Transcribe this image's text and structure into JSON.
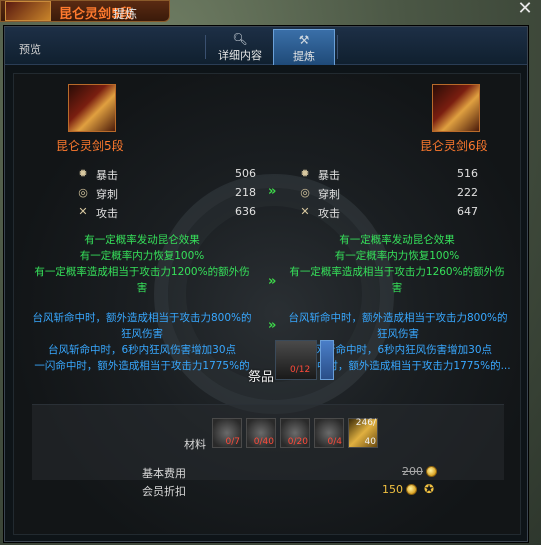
{
  "title": {
    "item_name": "昆仑灵剑5段",
    "mode": "提炼"
  },
  "header": {
    "preview_label": "预览",
    "tabs": [
      {
        "label": "详细内容",
        "icon": "magnifier-icon"
      },
      {
        "label": "提炼",
        "icon": "hammer-icon"
      }
    ],
    "active_tab": 1
  },
  "left_item": {
    "name": "昆仑灵剑5段",
    "stats": [
      {
        "icon": "crit-icon",
        "name": "暴击",
        "value": "506"
      },
      {
        "icon": "pierce-icon",
        "name": "穿刺",
        "value": "218"
      },
      {
        "icon": "attack-icon",
        "name": "攻击",
        "value": "636"
      }
    ],
    "effects_green": [
      "有一定概率发动昆仑效果",
      "有一定概率内力恢复100%",
      "有一定概率造成相当于攻击力1200%的额外伤",
      "害"
    ],
    "effects_blue": [
      "台风斩命中时，额外造成相当于攻击力800%的",
      "狂风伤害",
      "台风斩命中时，6秒内狂风伤害增加30点",
      "一闪命中时，额外造成相当于攻击力1775%的"
    ]
  },
  "right_item": {
    "name": "昆仑灵剑6段",
    "stats": [
      {
        "icon": "crit-icon",
        "name": "暴击",
        "value": "516"
      },
      {
        "icon": "pierce-icon",
        "name": "穿刺",
        "value": "222"
      },
      {
        "icon": "attack-icon",
        "name": "攻击",
        "value": "647"
      }
    ],
    "effects_green": [
      "有一定概率发动昆仑效果",
      "有一定概率内力恢复100%",
      "有一定概率造成相当于攻击力1260%的额外伤",
      "害"
    ],
    "effects_blue": [
      "台风斩命中时，额外造成相当于攻击力800%的",
      "狂风伤害",
      "台风斩命中时，6秒内狂风伤害增加30点",
      "一闪命中时，额外造成相当于攻击力1775%的..."
    ]
  },
  "center_slot": {
    "label": "祭品",
    "count": "0/12"
  },
  "materials": {
    "label": "材料",
    "items": [
      {
        "count": "0/7"
      },
      {
        "count": "0/40"
      },
      {
        "count": "0/20"
      },
      {
        "count": "0/4"
      },
      {
        "count": "40",
        "owned": "246/"
      }
    ]
  },
  "fees": {
    "base_label": "基本费用",
    "base_value": "200",
    "member_label": "会员折扣",
    "member_value": "150"
  },
  "colors": {
    "item_name": "#ff7a2e",
    "effect_green": "#36e05a",
    "effect_blue": "#38a8ff"
  }
}
